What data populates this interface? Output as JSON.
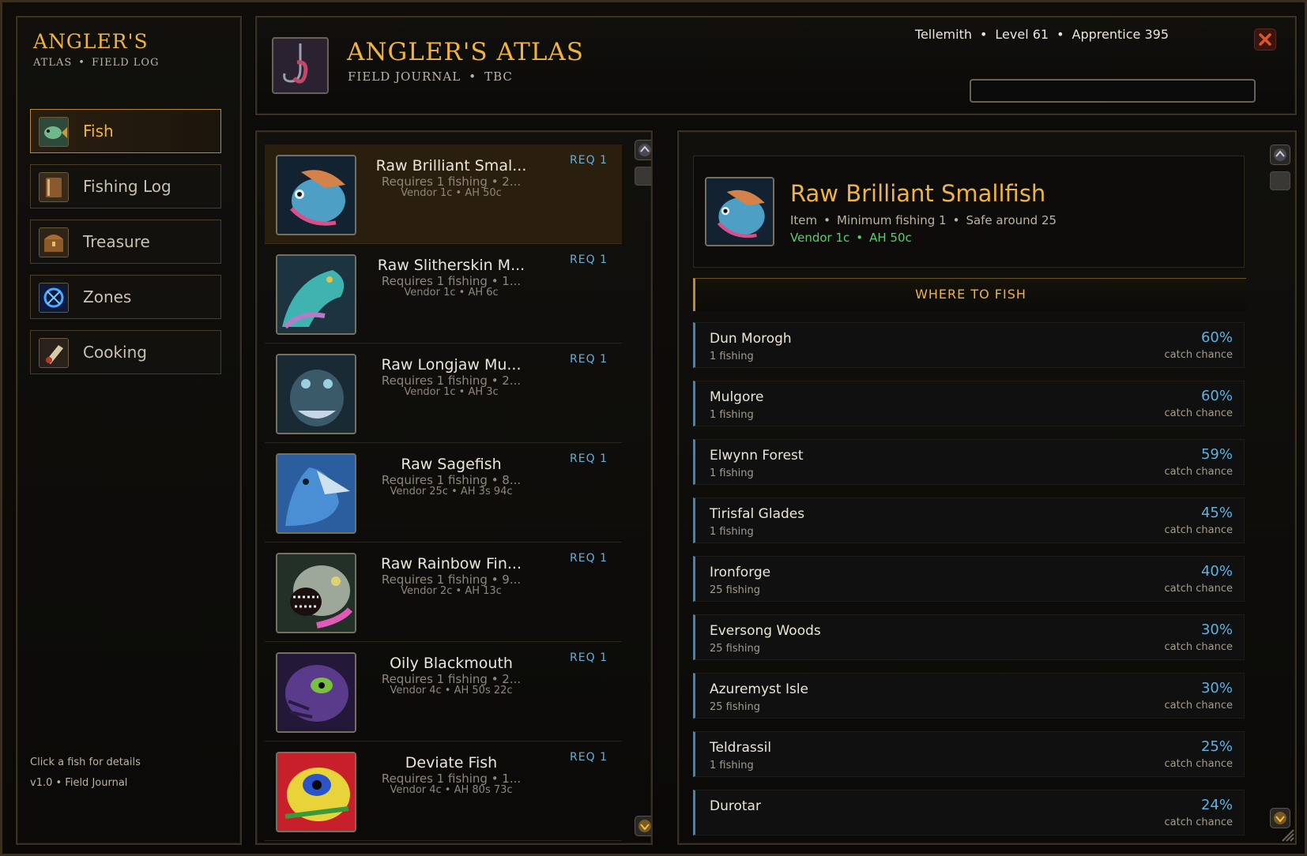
{
  "app": {
    "brand_title": "ANGLER'S",
    "brand_sub_a": "ATLAS",
    "brand_sub_b": "FIELD LOG",
    "header_title": "ANGLER'S ATLAS",
    "header_sub_a": "FIELD JOURNAL",
    "header_sub_b": "TBC",
    "accent_color": "#f0b43c"
  },
  "player": {
    "name": "Tellemith",
    "level": "Level 61",
    "skill": "Apprentice 395"
  },
  "search": {
    "value": "",
    "placeholder": ""
  },
  "nav": [
    {
      "label": "Fish",
      "icon": "fish-icon",
      "active": true
    },
    {
      "label": "Fishing Log",
      "icon": "book-icon",
      "active": false
    },
    {
      "label": "Treasure",
      "icon": "chest-icon",
      "active": false
    },
    {
      "label": "Zones",
      "icon": "map-rune-icon",
      "active": false
    },
    {
      "label": "Cooking",
      "icon": "cooking-icon",
      "active": false
    }
  ],
  "sidebar_footer": {
    "hint": "Click a fish for details",
    "version": "v1.0 • Field Journal"
  },
  "fish_list": [
    {
      "name": "Raw Brilliant Smal...",
      "req": "Requires 1 fishing  •  2...",
      "price": "Vendor 1c  •  AH 50c",
      "badge": "REQ 1",
      "active": true
    },
    {
      "name": "Raw Slitherskin M...",
      "req": "Requires 1 fishing  •  1...",
      "price": "Vendor 1c  •  AH 6c",
      "badge": "REQ 1",
      "active": false
    },
    {
      "name": "Raw Longjaw Mu...",
      "req": "Requires 1 fishing  •  2...",
      "price": "Vendor 1c  •  AH 3c",
      "badge": "REQ 1",
      "active": false
    },
    {
      "name": "Raw Sagefish",
      "req": "Requires 1 fishing  •  8...",
      "price": "Vendor 25c  •  AH 3s 94c",
      "badge": "REQ 1",
      "active": false
    },
    {
      "name": "Raw Rainbow Fin...",
      "req": "Requires 1 fishing  •  9...",
      "price": "Vendor 2c  •  AH 13c",
      "badge": "REQ 1",
      "active": false
    },
    {
      "name": "Oily Blackmouth",
      "req": "Requires 1 fishing  •  2...",
      "price": "Vendor 4c  •  AH 50s 22c",
      "badge": "REQ 1",
      "active": false
    },
    {
      "name": "Deviate Fish",
      "req": "Requires 1 fishing  •  1...",
      "price": "Vendor 4c  •  AH 80s 73c",
      "badge": "REQ 1",
      "active": false
    }
  ],
  "detail": {
    "name": "Raw Brilliant Smallfish",
    "type": "Item",
    "min_fishing": "Minimum fishing 1",
    "safe": "Safe around 25",
    "vendor": "Vendor 1c",
    "ah": "AH 50c",
    "where_title": "WHERE TO FISH",
    "zones": [
      {
        "name": "Dun Morogh",
        "skill": "1 fishing",
        "pct": "60%",
        "label": "catch chance"
      },
      {
        "name": "Mulgore",
        "skill": "1 fishing",
        "pct": "60%",
        "label": "catch chance"
      },
      {
        "name": "Elwynn Forest",
        "skill": "1 fishing",
        "pct": "59%",
        "label": "catch chance"
      },
      {
        "name": "Tirisfal Glades",
        "skill": "1 fishing",
        "pct": "45%",
        "label": "catch chance"
      },
      {
        "name": "Ironforge",
        "skill": "25 fishing",
        "pct": "40%",
        "label": "catch chance"
      },
      {
        "name": "Eversong Woods",
        "skill": "25 fishing",
        "pct": "30%",
        "label": "catch chance"
      },
      {
        "name": "Azuremyst Isle",
        "skill": "25 fishing",
        "pct": "30%",
        "label": "catch chance"
      },
      {
        "name": "Teldrassil",
        "skill": "1 fishing",
        "pct": "25%",
        "label": "catch chance"
      },
      {
        "name": "Durotar",
        "skill": "",
        "pct": "24%",
        "label": "catch chance"
      }
    ]
  }
}
